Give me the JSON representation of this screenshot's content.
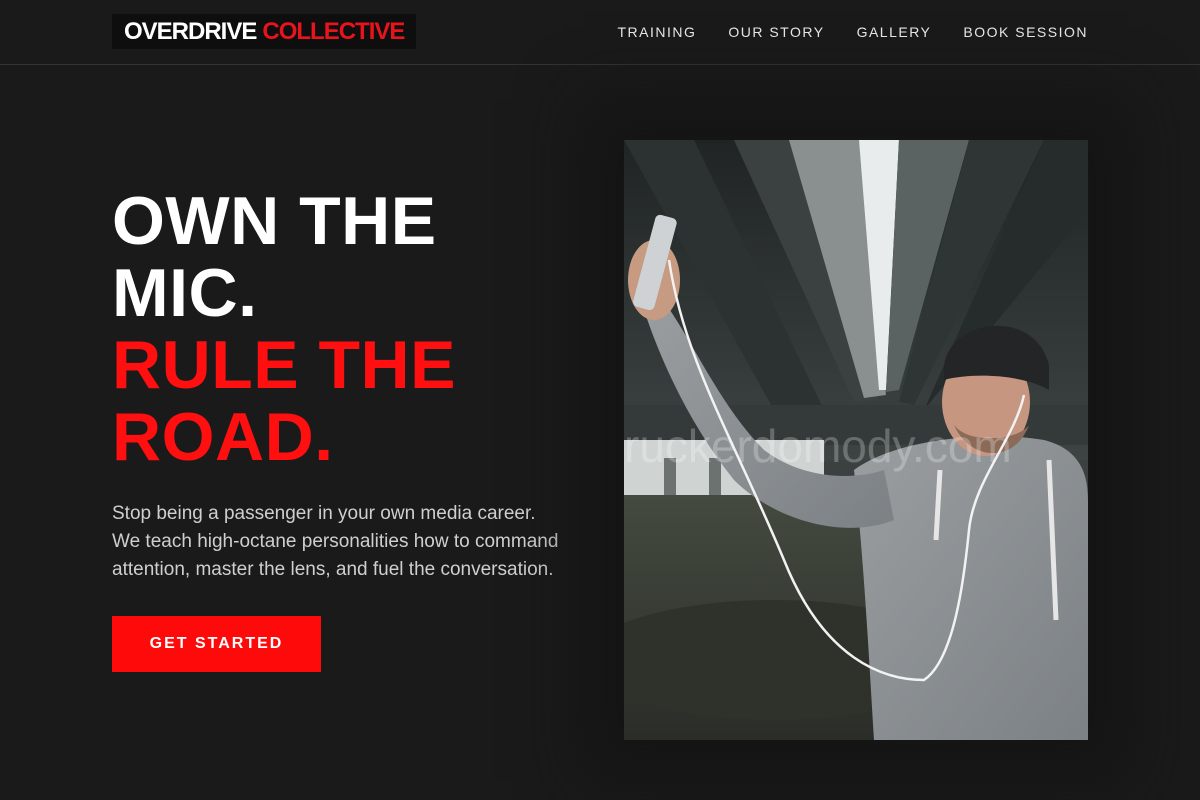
{
  "header": {
    "logo_primary": "OVERDRIVE",
    "logo_accent": "COLLECTIVE",
    "nav": [
      {
        "label": "TRAINING"
      },
      {
        "label": "OUR STORY"
      },
      {
        "label": "GALLERY"
      },
      {
        "label": "BOOK SESSION"
      }
    ]
  },
  "hero": {
    "headline_white_1": "OWN THE",
    "headline_white_2": "MIC.",
    "headline_red_1": "RULE THE",
    "headline_red_2": "ROAD.",
    "subtext": "Stop being a passenger in your own media career. We teach high-octane personalities how to command attention, master the lens, and fuel the conversation.",
    "cta_label": "GET STARTED",
    "photo_watermark": "ruckerdomody.com"
  },
  "colors": {
    "background": "#1a1a1a",
    "accent_red": "#ff0a0a",
    "text_white": "#ffffff",
    "text_muted": "#cfcfcf"
  }
}
